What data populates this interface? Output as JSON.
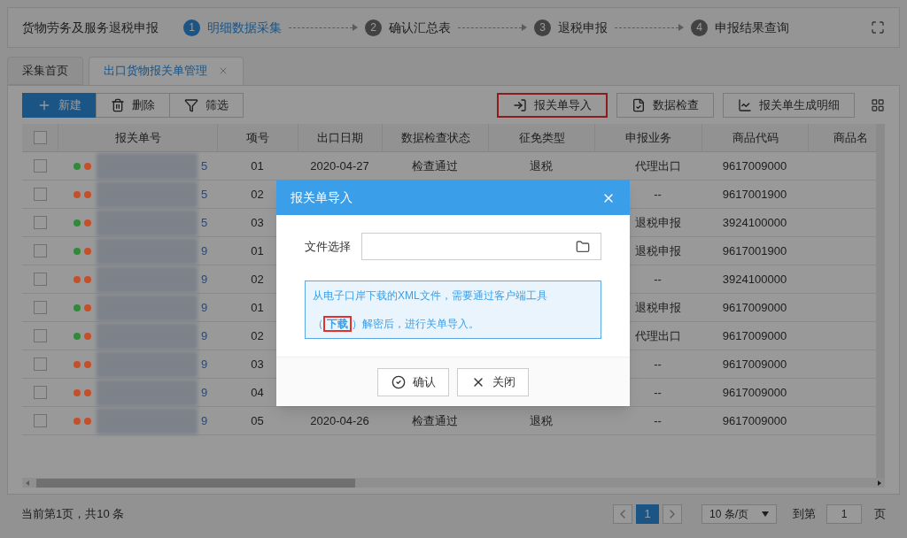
{
  "header": {
    "title": "货物劳务及服务退税申报",
    "steps": [
      {
        "number": "1",
        "label": "明细数据采集",
        "selected": true
      },
      {
        "number": "2",
        "label": "确认汇总表",
        "selected": false
      },
      {
        "number": "3",
        "label": "退税申报",
        "selected": false
      },
      {
        "number": "4",
        "label": "申报结果查询",
        "selected": false
      }
    ]
  },
  "tabs": [
    {
      "label": "采集首页",
      "selected": false,
      "closable": false
    },
    {
      "label": "出口货物报关单管理",
      "selected": true,
      "closable": true
    }
  ],
  "toolbar": {
    "left": [
      {
        "kind": "new",
        "label": "新建"
      },
      {
        "kind": "delete",
        "label": "删除"
      },
      {
        "kind": "filter",
        "label": "筛选"
      }
    ],
    "right": [
      {
        "kind": "import",
        "label": "报关单导入",
        "highlighted": true
      },
      {
        "kind": "check",
        "label": "数据检查",
        "highlighted": false
      },
      {
        "kind": "chart",
        "label": "报关单生成明细",
        "highlighted": false
      }
    ]
  },
  "table": {
    "columns": [
      "报关单号",
      "项号",
      "出口日期",
      "数据检查状态",
      "征免类型",
      "申报业务",
      "商品代码",
      "商品名"
    ],
    "select_all_checked": false,
    "rows": [
      {
        "checked": false,
        "dots": [
          {
            "color": "#2e8b3a"
          },
          {
            "color": "#c4502a"
          }
        ],
        "id_tail": "5",
        "item": "01",
        "date": "2020-04-27",
        "check_status": "检查通过",
        "tax_type": "退税",
        "business": "代理出口",
        "code": "9617009000"
      },
      {
        "checked": false,
        "dots": [
          {
            "color": "#c4502a"
          },
          {
            "color": "#c4502a"
          }
        ],
        "id_tail": "5",
        "item": "02",
        "business": "--",
        "code": "9617001900"
      },
      {
        "checked": false,
        "dots": [
          {
            "color": "#2e8b3a"
          },
          {
            "color": "#c4502a"
          }
        ],
        "id_tail": "5",
        "item": "03",
        "business": "退税申报",
        "code": "3924100000"
      },
      {
        "checked": false,
        "dots": [
          {
            "color": "#2e8b3a"
          },
          {
            "color": "#c4502a"
          }
        ],
        "id_tail": "9",
        "item": "01",
        "business": "退税申报",
        "code": "9617001900"
      },
      {
        "checked": false,
        "dots": [
          {
            "color": "#c4502a"
          },
          {
            "color": "#c4502a"
          }
        ],
        "id_tail": "9",
        "item": "02",
        "business": "--",
        "code": "3924100000"
      },
      {
        "checked": false,
        "dots": [
          {
            "color": "#2e8b3a"
          },
          {
            "color": "#c4502a"
          }
        ],
        "id_tail": "9",
        "item": "01",
        "business": "退税申报",
        "code": "9617009000"
      },
      {
        "checked": false,
        "dots": [
          {
            "color": "#2e8b3a"
          },
          {
            "color": "#c4502a"
          }
        ],
        "id_tail": "9",
        "item": "02",
        "business": "代理出口",
        "code": "9617009000"
      },
      {
        "checked": false,
        "dots": [
          {
            "color": "#c4502a"
          },
          {
            "color": "#c4502a"
          }
        ],
        "id_tail": "9",
        "item": "03",
        "business": "--",
        "code": "9617009000"
      },
      {
        "checked": false,
        "dots": [
          {
            "color": "#c4502a"
          },
          {
            "color": "#c4502a"
          }
        ],
        "id_tail": "9",
        "item": "04",
        "business": "--",
        "code": "9617009000"
      },
      {
        "checked": false,
        "dots": [
          {
            "color": "#c4502a"
          },
          {
            "color": "#c4502a"
          }
        ],
        "id_tail": "9",
        "item": "05",
        "date": "2020-04-26",
        "check_status": "检查通过",
        "tax_type": "退税",
        "business": "--",
        "code": "9617009000"
      }
    ]
  },
  "footer": {
    "summary": "当前第1页，共10 条",
    "pages": [
      {
        "label": "1",
        "selected": true
      }
    ],
    "page_size": "10 条/页",
    "goto_label": "到第",
    "goto_value": "1",
    "goto_suffix": "页"
  },
  "dialog": {
    "title": "报关单导入",
    "file_label": "文件选择",
    "notice_before": "从电子口岸下载的XML文件，需要通过客户端工具（",
    "link": "下载",
    "link_highlighted": true,
    "notice_after": "）解密后，进行关单导入。",
    "buttons": [
      {
        "kind": "confirm",
        "label": "确认"
      },
      {
        "kind": "close",
        "label": "关闭"
      }
    ]
  }
}
